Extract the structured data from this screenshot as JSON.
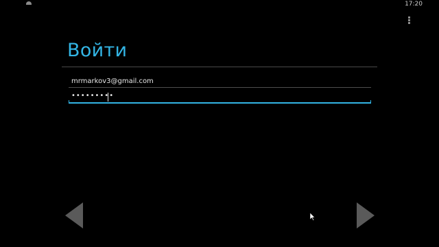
{
  "status_bar": {
    "time": "17:20"
  },
  "screen": {
    "title": "Войти",
    "email_value": "mrmarkov3@gmail.com",
    "password_value": "•••••••••"
  },
  "navigation": {
    "back_icon": "triangle-left",
    "next_icon": "triangle-right"
  },
  "colors": {
    "accent": "#33b5e5",
    "background": "#000000",
    "arrow": "#5a5a5a"
  }
}
